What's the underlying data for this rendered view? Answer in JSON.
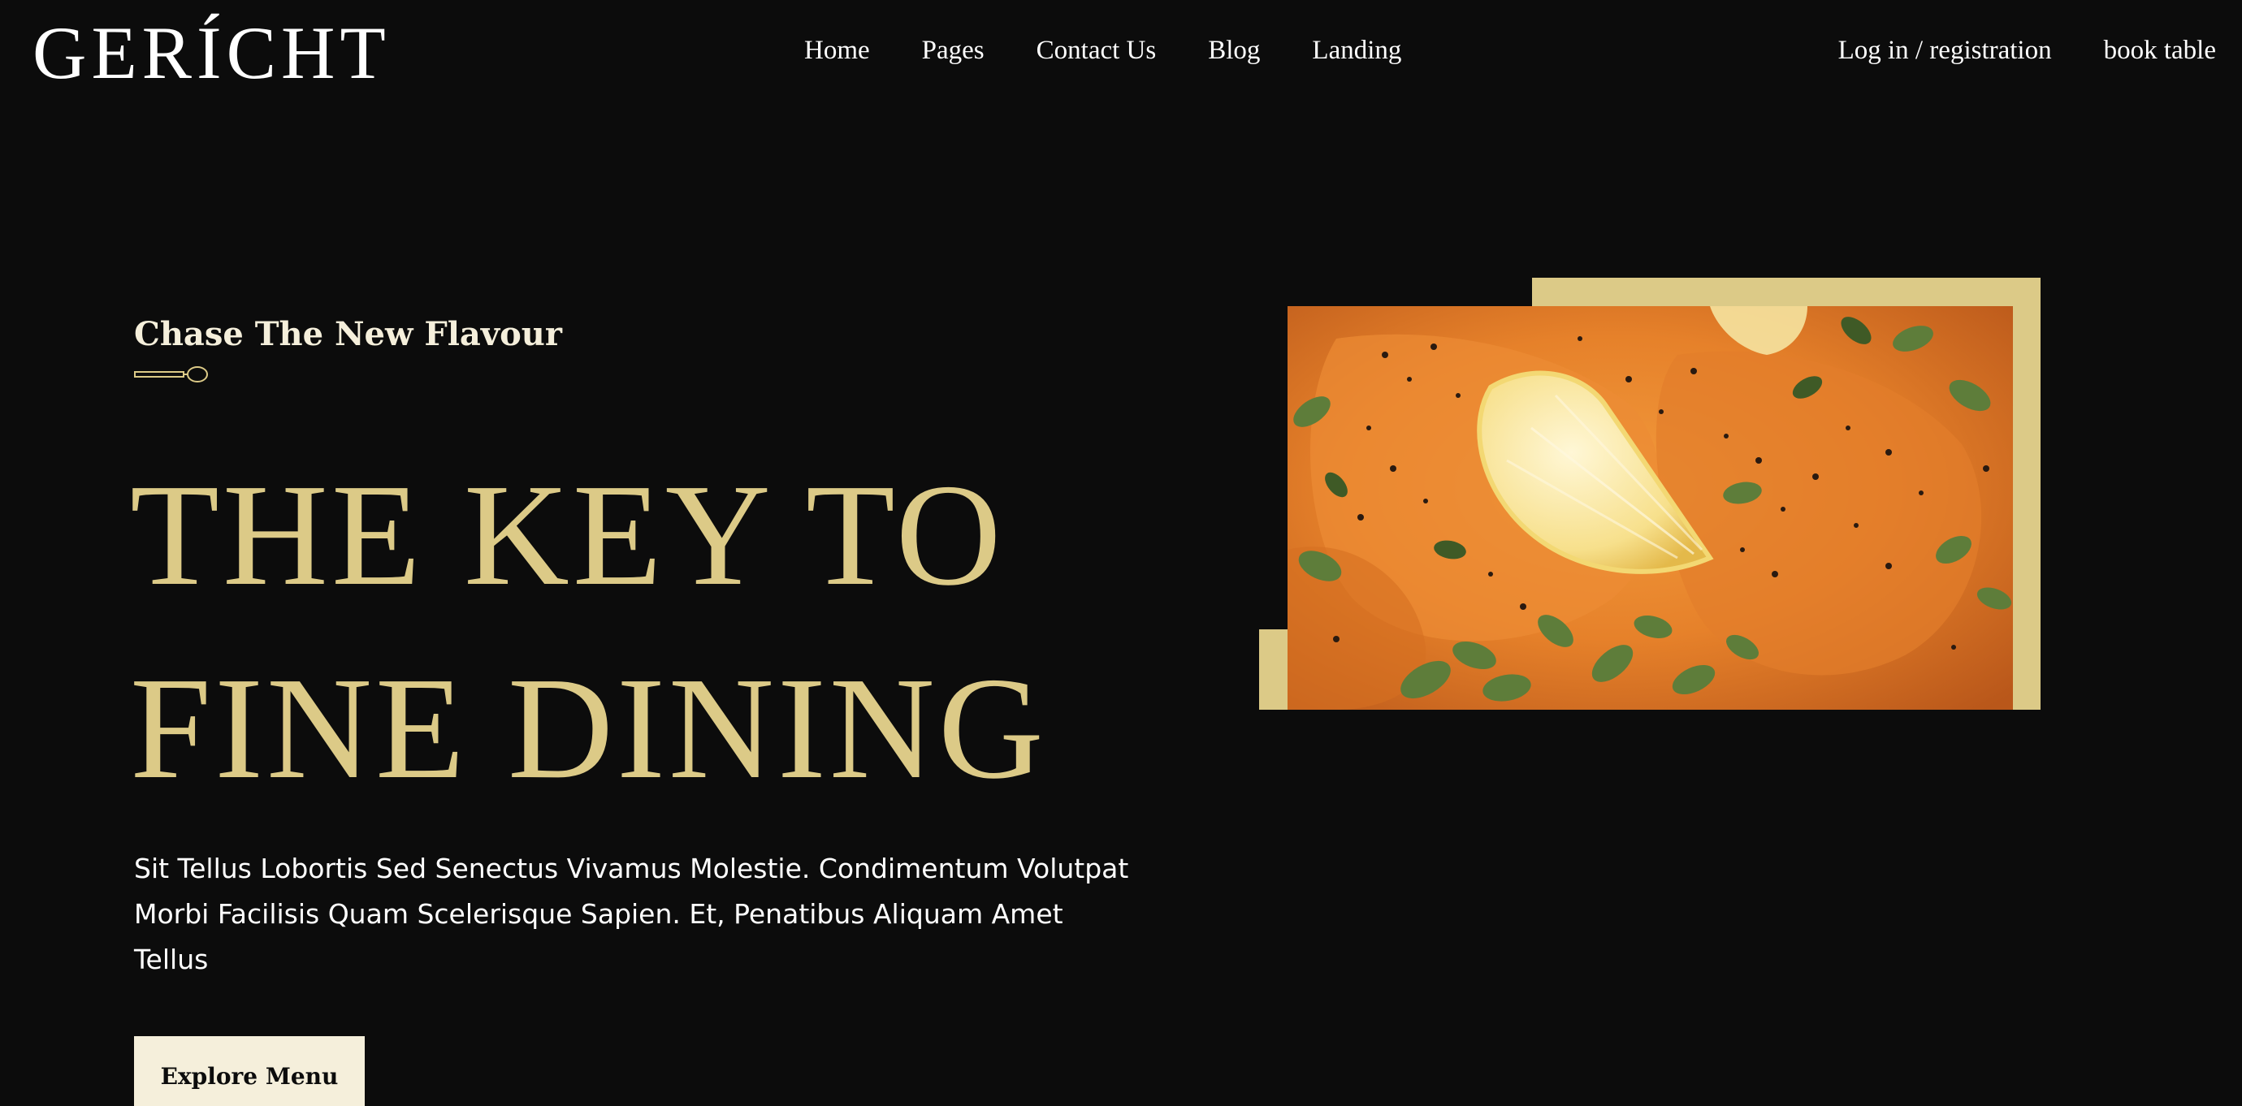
{
  "header": {
    "logo": "GERÍCHT",
    "nav": [
      {
        "label": "Home"
      },
      {
        "label": "Pages"
      },
      {
        "label": "Contact Us"
      },
      {
        "label": "Blog"
      },
      {
        "label": "Landing"
      }
    ],
    "login_label": "Log in / registration",
    "book_label": "book table"
  },
  "hero": {
    "subtitle": "Chase The New Flavour",
    "headline_line1": "THE KEY TO",
    "headline_line2": "FINE DINING",
    "description": "Sit Tellus Lobortis Sed Senectus Vivamus Molestie. Condimentum Volutpat Morbi Facilisis Quam Scelerisque Sapien. Et, Penatibus Aliquam Amet Tellus",
    "cta_label": "Explore Menu"
  },
  "colors": {
    "background": "#0c0c0c",
    "gold": "#dcca87",
    "cream": "#f5efdb",
    "white": "#ffffff"
  },
  "icons": {
    "spoon": "spoon-divider-icon"
  }
}
